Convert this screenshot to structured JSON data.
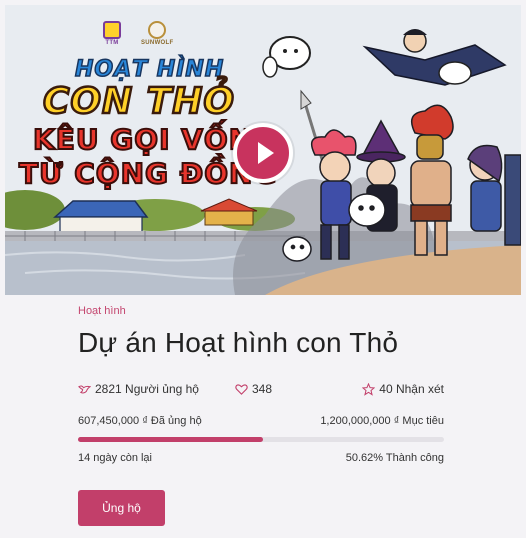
{
  "banner": {
    "logos": [
      "TTM",
      "SUNWOLF"
    ],
    "title_lines": [
      "HOẠT HÌNH",
      "CON THỎ",
      "KÊU GỌI VỐN",
      "TỪ CỘNG ĐỒNG"
    ],
    "play_icon": "play-icon"
  },
  "project": {
    "category": "Hoạt hình",
    "title": "Dự án Hoạt hình con Thỏ",
    "supporters": "2821 Người ủng hộ",
    "likes": "348",
    "reviews": "40 Nhận xét",
    "raised": "607,450,000 ₫ Đã ủng hộ",
    "goal": "1,200,000,000 ₫ Mục tiêu",
    "progress_percent": 50.62,
    "days_left": "14 ngày còn lại",
    "success_rate": "50.62% Thành công",
    "support_button": "Ủng hộ"
  },
  "colors": {
    "accent": "#c23f6a",
    "progress_track": "#e3e1e6"
  }
}
